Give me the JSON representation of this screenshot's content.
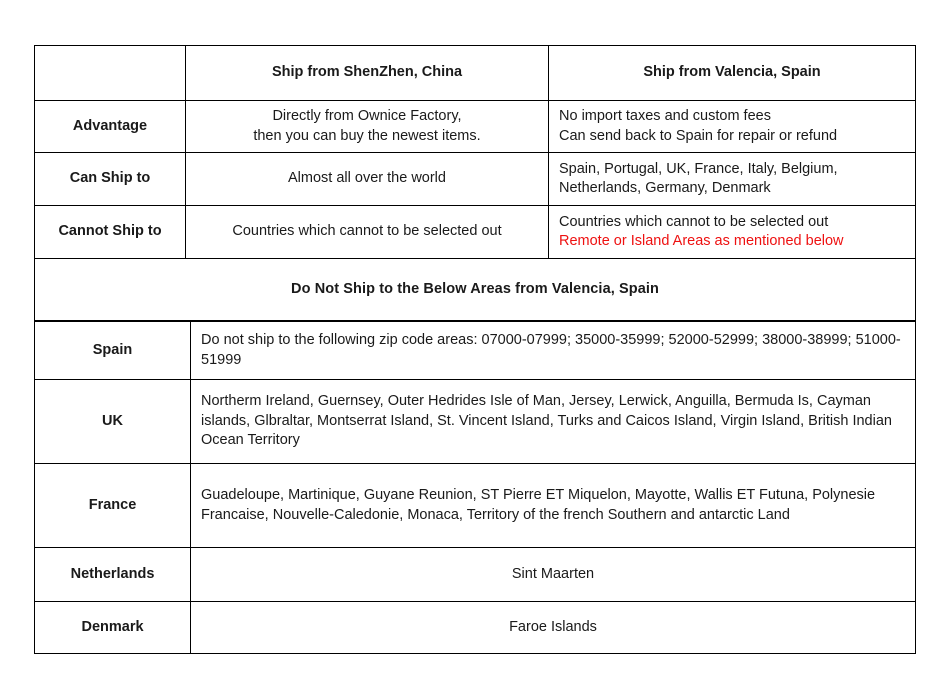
{
  "colors": {
    "red": "#ee1111",
    "text": "#1a1a1a",
    "border": "#000000",
    "background": "#ffffff"
  },
  "comparison": {
    "headers": {
      "corner": "",
      "china": "Ship from ShenZhen, China",
      "spain": "Ship from Valencia, Spain"
    },
    "rows": [
      {
        "label": "Advantage",
        "china_lines": [
          "Directly from Ownice Factory,",
          "then you can buy the newest items."
        ],
        "spain_lines": [
          "No import taxes and custom fees",
          "Can send back to Spain for repair or refund"
        ]
      },
      {
        "label": "Can Ship to",
        "china_lines": [
          "Almost all over the world"
        ],
        "spain_lines": [
          "Spain, Portugal, UK, France, Italy, Belgium,",
          "Netherlands, Germany, Denmark"
        ]
      },
      {
        "label": "Cannot Ship to",
        "china_lines": [
          "Countries which cannot to be selected out"
        ],
        "spain_lines": [
          "Countries which cannot to be selected out",
          "Remote or Island Areas as mentioned below"
        ]
      }
    ]
  },
  "banner": {
    "text": "Do Not Ship to the Below Areas from Valencia, Spain"
  },
  "areas": [
    {
      "label": "Spain",
      "text": "Do not ship to the following zip code areas: 07000-07999; 35000-35999; 52000-52999; 38000-38999; 51000-51999",
      "align": "left"
    },
    {
      "label": "UK",
      "text": "Northerm Ireland, Guernsey, Outer Hedrides Isle of Man, Jersey, Lerwick, Anguilla, Bermuda Is, Cayman islands, Glbraltar, Montserrat Island, St. Vincent Island, Turks and Caicos Island, Virgin Island, British Indian Ocean Territory",
      "align": "left"
    },
    {
      "label": "France",
      "text": "Guadeloupe, Martinique, Guyane Reunion, ST Pierre ET Miquelon, Mayotte, Wallis ET Futuna, Polynesie Francaise, Nouvelle-Caledonie, Monaca, Territory of the french Southern and antarctic Land",
      "align": "left"
    },
    {
      "label": "Netherlands",
      "text": "Sint Maarten",
      "align": "center"
    },
    {
      "label": "Denmark",
      "text": "Faroe Islands",
      "align": "center"
    }
  ]
}
